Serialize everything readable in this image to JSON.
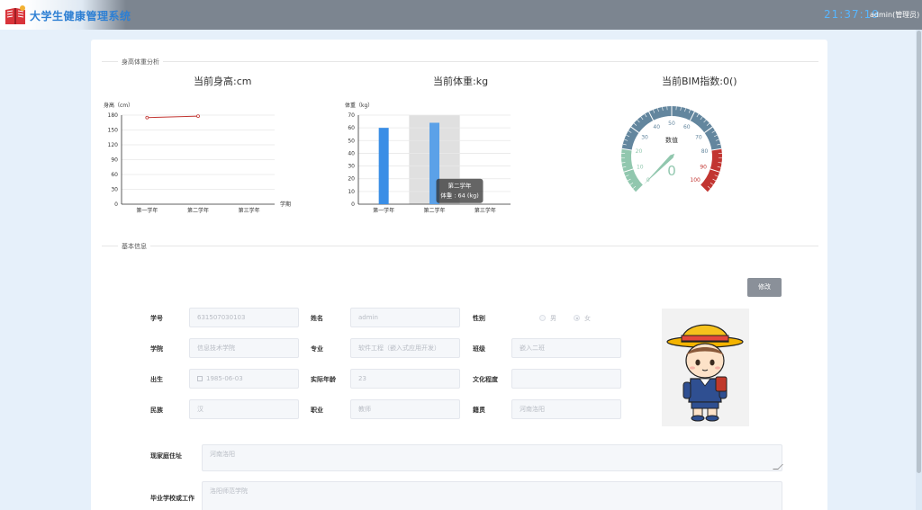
{
  "header": {
    "app_title": "大学生健康管理系统",
    "clock": "21:37:19",
    "user": "admin(管理员)",
    "dropdown_icon": "chevron-down-icon",
    "logo_icon": "book-logo-icon"
  },
  "analysis": {
    "section_title": "身高体重分析",
    "height_title": "当前身高:cm",
    "weight_title": "当前体重:kg",
    "bmi_title": "当前BIM指数:0()"
  },
  "chart_data": [
    {
      "type": "line",
      "title": "当前身高:cm",
      "ylabel": "身高（cm）",
      "xlabel": "学期",
      "categories": [
        "第一学年",
        "第二学年",
        "第三学年"
      ],
      "values": [
        175,
        178,
        null
      ],
      "ylim": [
        0,
        180
      ],
      "yticks": [
        0,
        30,
        60,
        90,
        120,
        150,
        180
      ],
      "grid": true,
      "color": "#c23531"
    },
    {
      "type": "bar",
      "title": "当前体重:kg",
      "ylabel": "体重（kg）",
      "categories": [
        "第一学年",
        "第二学年",
        "第三学年"
      ],
      "values": [
        60,
        64,
        null
      ],
      "ylim": [
        0,
        70
      ],
      "yticks": [
        0,
        10,
        20,
        30,
        40,
        50,
        60,
        70
      ],
      "grid": true,
      "color": "#3a8ee6",
      "highlighted_category": "第二学年",
      "tooltip": {
        "title": "第二学年",
        "line": "体重 : 64 (kg)"
      }
    },
    {
      "type": "gauge",
      "title": "当前BIM指数:0()",
      "label": "数值",
      "value": 0,
      "range": [
        0,
        100
      ],
      "ticks": [
        0,
        10,
        20,
        30,
        40,
        50,
        60,
        70,
        80,
        90,
        100
      ],
      "bands": [
        {
          "to": 0.2,
          "color": "#91c7ae"
        },
        {
          "to": 0.8,
          "color": "#63869e"
        },
        {
          "to": 1.0,
          "color": "#c23531"
        }
      ]
    }
  ],
  "basic": {
    "section_title": "基本信息",
    "edit_button": "修改",
    "fields": {
      "student_id": {
        "label": "学号",
        "value": "631507030103"
      },
      "name": {
        "label": "姓名",
        "value": "admin"
      },
      "gender": {
        "label": "性别",
        "options": [
          "男",
          "女"
        ],
        "selected": "女"
      },
      "college": {
        "label": "学院",
        "value": "信息技术学院"
      },
      "major": {
        "label": "专业",
        "value": "软件工程（嵌入式应用开发）"
      },
      "class": {
        "label": "班级",
        "value": "嵌入二班"
      },
      "birth": {
        "label": "出生",
        "value": "1985-06-03"
      },
      "age": {
        "label": "实际年龄",
        "value": "23"
      },
      "education": {
        "label": "文化程度",
        "value": ""
      },
      "ethnicity": {
        "label": "民族",
        "value": "汉"
      },
      "occupation": {
        "label": "职业",
        "value": "教师"
      },
      "origin": {
        "label": "籍贯",
        "value": "河南洛阳"
      },
      "address": {
        "label": "现家庭住址",
        "value": "河南洛阳"
      },
      "school": {
        "label": "毕业学校或工作单位",
        "value": "洛阳师范学院"
      }
    },
    "avatar": "student-avatar"
  }
}
